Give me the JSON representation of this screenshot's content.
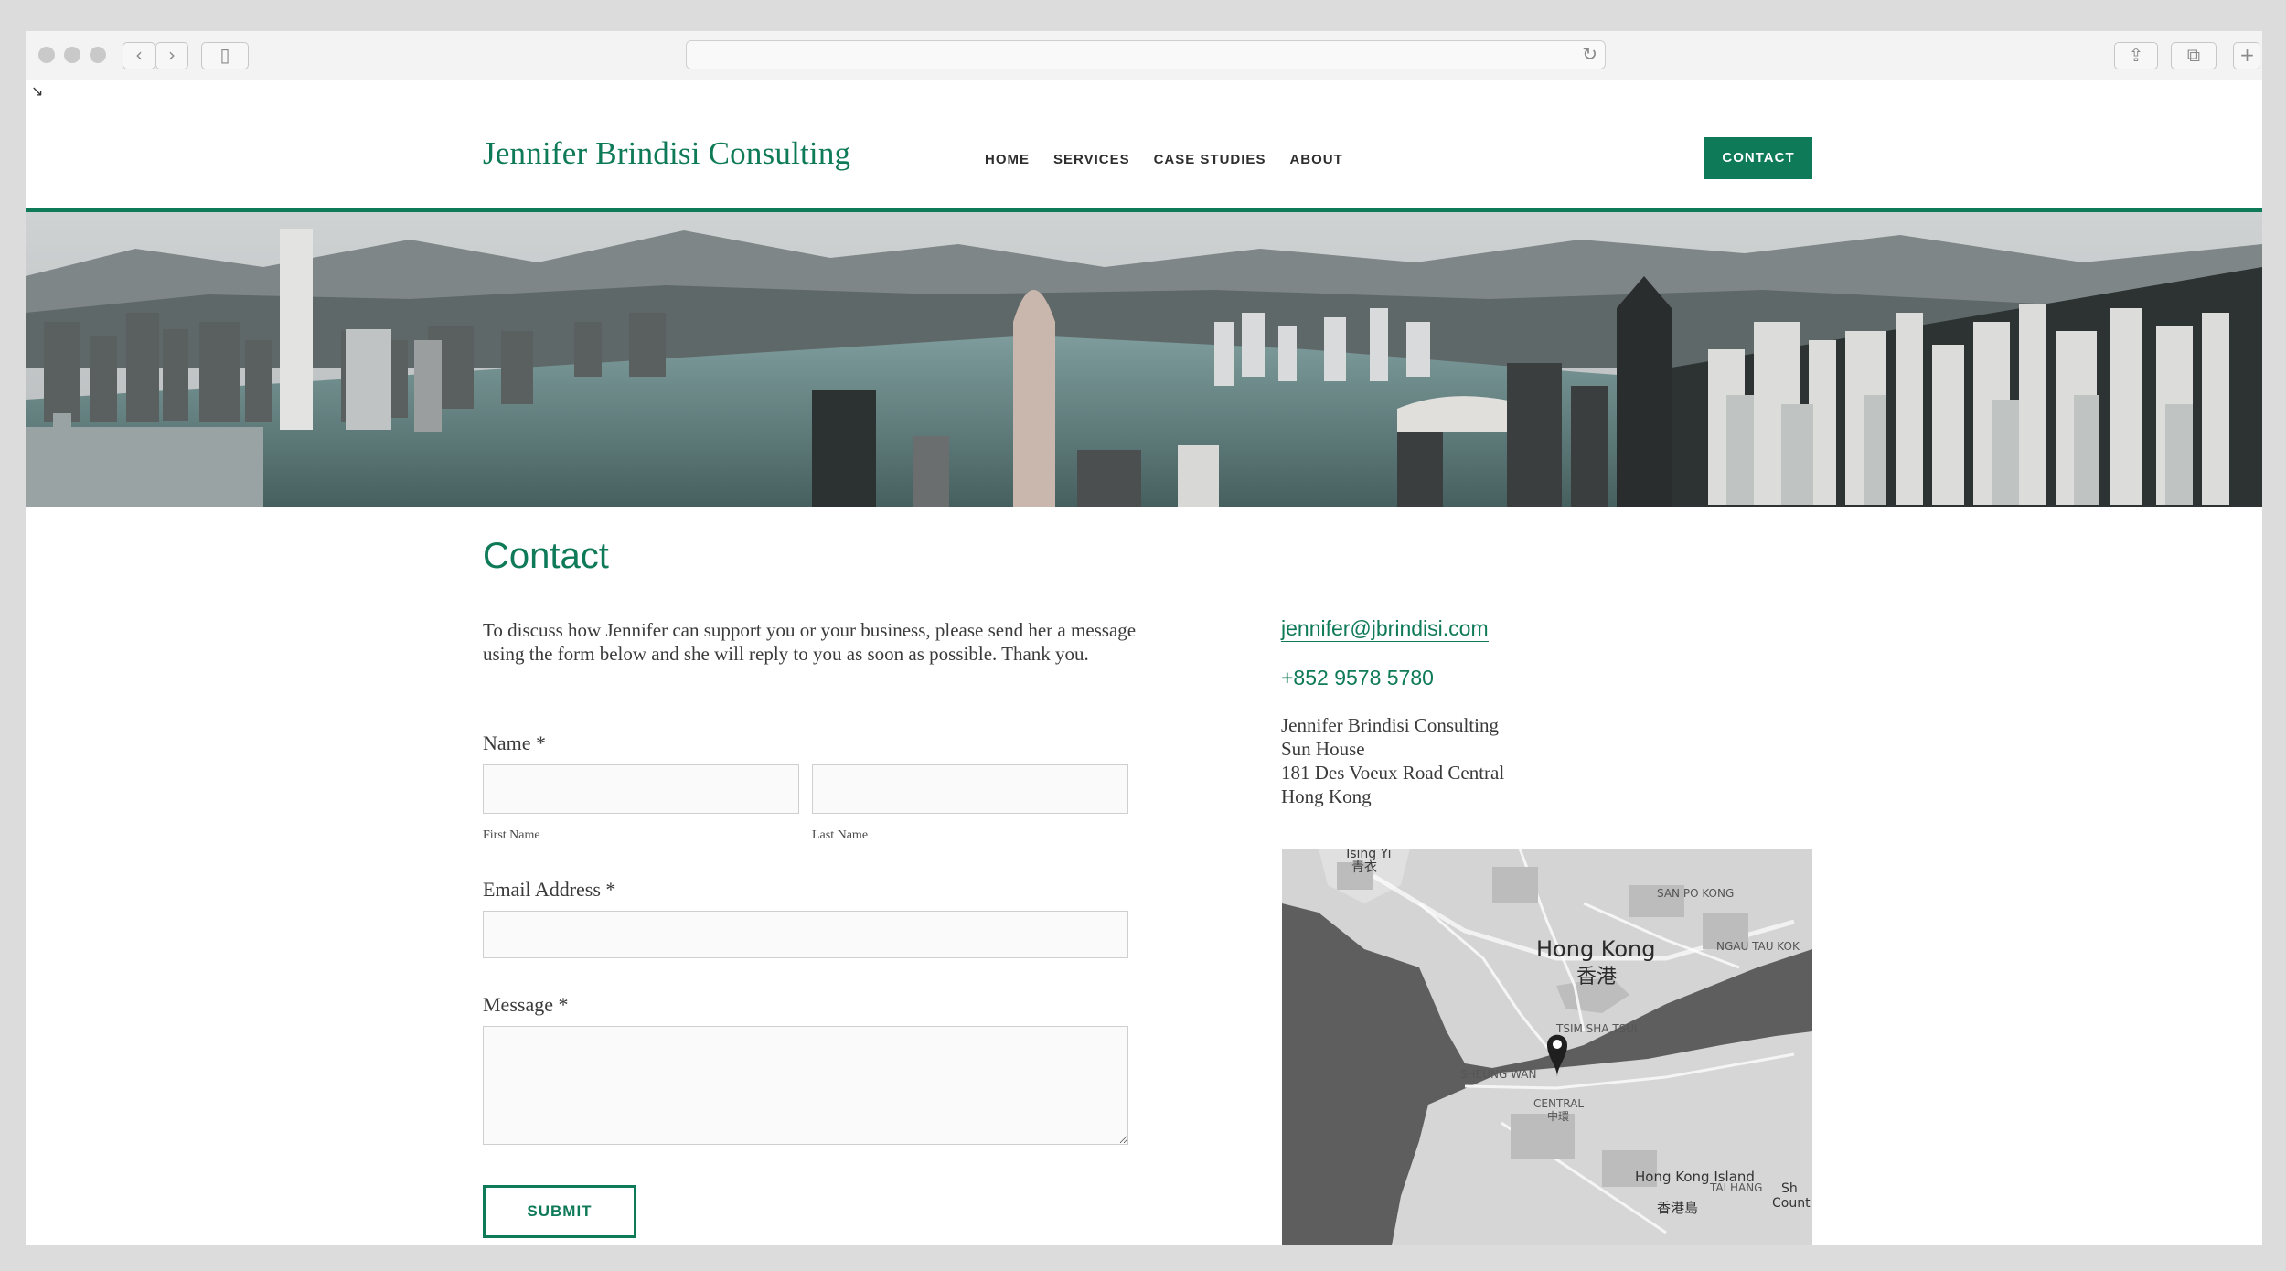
{
  "site": {
    "title": "Jennifer Brindisi Consulting",
    "nav": [
      "HOME",
      "SERVICES",
      "CASE STUDIES",
      "ABOUT"
    ],
    "contact_button": "CONTACT"
  },
  "colors": {
    "accent": "#0f7a58",
    "text": "#333333",
    "input_border": "#cfcfcf"
  },
  "page": {
    "heading": "Contact",
    "intro": "To discuss how Jennifer can support you or your business, please send her a message using the form below and she will reply to you as soon as possible. Thank you."
  },
  "form": {
    "name_label": "Name *",
    "first_name_sub": "First Name",
    "last_name_sub": "Last Name",
    "email_label": "Email Address *",
    "message_label": "Message *",
    "submit_label": "SUBMIT",
    "first_name_value": "",
    "last_name_value": "",
    "email_value": "",
    "message_value": ""
  },
  "contact": {
    "email": "jennifer@jbrindisi.com",
    "phone": "+852 9578 5780",
    "address": [
      "Jennifer Brindisi Consulting",
      "Sun House",
      "181 Des Voeux Road Central",
      "Hong Kong"
    ]
  },
  "map": {
    "labels": {
      "hong_kong": "Hong Kong",
      "hong_kong_zh": "香港",
      "tsing_yi": "Tsing Yi",
      "tsing_yi_zh": "青衣",
      "san_po_kong": "SAN PO KONG",
      "ngau_tau_kok": "NGAU TAU KOK",
      "tsim_sha_tsui": "TSIM SHA TSUI",
      "central": "CENTRAL",
      "central_zh": "中環",
      "hk_island": "Hong Kong Island",
      "hk_island_zh": "香港島",
      "sheung_wan": "SHEUNG WAN",
      "tai_hang": "TAI HANG",
      "country": "Count",
      "sh": "Sh"
    }
  }
}
